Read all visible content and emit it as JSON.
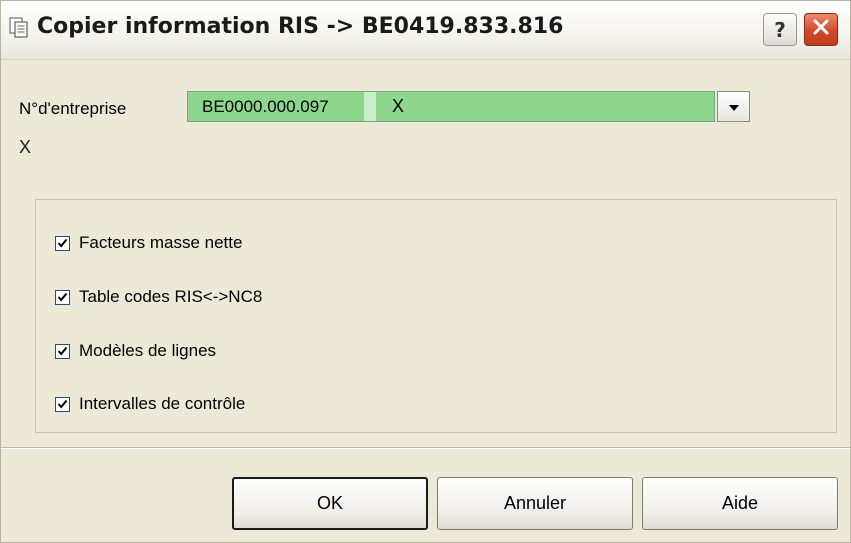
{
  "window": {
    "title": "Copier information RIS -> BE0419.833.816",
    "help_button": "?",
    "icons": {
      "title": "copy-document-icon",
      "close": "close-icon"
    }
  },
  "form": {
    "company_label": "N°d'entreprise",
    "company_value": "BE0000.000.097",
    "company_suffix": "X",
    "below_mark": "X"
  },
  "options": [
    {
      "label": "Facteurs masse nette",
      "checked": true
    },
    {
      "label": "Table codes RIS<->NC8",
      "checked": true
    },
    {
      "label": "Modèles de lignes",
      "checked": true
    },
    {
      "label": "Intervalles de contrôle",
      "checked": true
    }
  ],
  "buttons": {
    "ok": "OK",
    "cancel": "Annuler",
    "help": "Aide"
  },
  "colors": {
    "combo_background": "#8ed68e",
    "dialog_background": "#ece9d8",
    "close_button": "#d14a2a"
  }
}
